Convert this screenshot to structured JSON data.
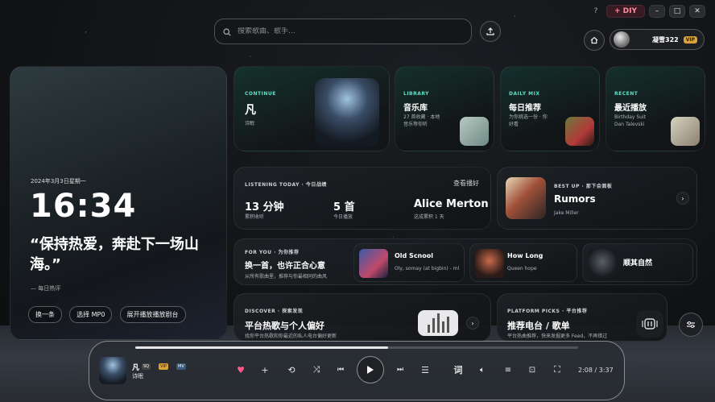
{
  "window": {
    "help_label": "?",
    "diy_label": "+ DIY",
    "minimize_label": "–",
    "maximize_label": "□",
    "close_label": "✕"
  },
  "search": {
    "placeholder": "搜索歌曲、歌手..."
  },
  "user": {
    "name": "凝雪322",
    "badge": "VIP"
  },
  "hero": {
    "date": "2024年3月3日星期一",
    "time": "16:34",
    "quote": "“保持热爱，奔赴下一场山海。”",
    "quote_source": "— 每日热评",
    "buttons": [
      "换一条",
      "选择 MP0",
      "展开播放播放剧台"
    ]
  },
  "cards": {
    "continue": {
      "label": "CONTINUE",
      "title": "凡",
      "subtitle": "诗眠"
    },
    "library": {
      "label": "LIBRARY",
      "title": "音乐库",
      "desc": "27 首收藏 · 本地\n音乐等你听"
    },
    "daily": {
      "label": "DAILY MIX",
      "title": "每日推荐",
      "desc": "为你挑选一份 · 你\n好看"
    },
    "recent": {
      "label": "RECENT",
      "title": "最近播放",
      "desc": "Birthday Suit\nDan Talevski"
    }
  },
  "listening": {
    "label": "LISTENING TODAY · 今日战绩",
    "link": "查看播好",
    "stats": [
      {
        "value": "13 分钟",
        "caption": "累积收听"
      },
      {
        "value": "5 首",
        "caption": "今日播放"
      },
      {
        "value": "Alice Merton",
        "caption": "这成累积 1 天"
      }
    ]
  },
  "bestup": {
    "label": "BEST UP · 那下会面板",
    "title": "Rumors",
    "artist": "Jake Miller"
  },
  "foryou": {
    "label": "FOR YOU · 为你推荐",
    "title": "换一首，也许正合心意",
    "desc": "从所有歌曲里，推荐与你最相同的曲风",
    "tracks": [
      {
        "title": "Old Scnool",
        "artist": "Oly, somay (at bigbin) - ml -"
      },
      {
        "title": "How Long",
        "artist": "Queen hope"
      },
      {
        "title": "顺其自然",
        "artist": ""
      }
    ]
  },
  "discover": {
    "label": "DISCOVER · 探索发现",
    "title": "平台热歌与个人偏好",
    "desc": "找你平台热歌和你最近的私人电台偏好更新"
  },
  "platform": {
    "label": "PLATFORM PICKS · 平台推荐",
    "title": "推荐电台 / 歌单",
    "desc": "平台热曲推荐，快来发掘更多 Feed，不再错过"
  },
  "player": {
    "title": "凡",
    "artist": "诗眠",
    "tags": [
      "SQ",
      "VIP",
      "MV"
    ],
    "lyric_label": "词",
    "time": "2:08 / 3:37",
    "progress": 0.57,
    "liked": true
  },
  "colors": {
    "accent": "#ff5c8a",
    "teal": "#5fe0c6",
    "vip": "#d8a43a"
  }
}
